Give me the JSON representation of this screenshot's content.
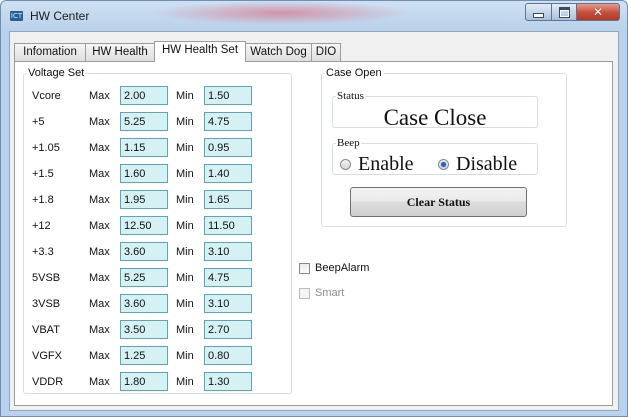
{
  "window": {
    "title": "HW Center",
    "icon_text": "ICT"
  },
  "tabs": [
    {
      "label": "Infomation"
    },
    {
      "label": "HW Health"
    },
    {
      "label": "HW Health Set"
    },
    {
      "label": "Watch Dog"
    },
    {
      "label": "DIO"
    }
  ],
  "active_tab": "HW Health Set",
  "voltage_set": {
    "legend": "Voltage Set",
    "max_label": "Max",
    "min_label": "Min",
    "rows": [
      {
        "name": "Vcore",
        "max": "2.00",
        "min": "1.50"
      },
      {
        "name": "+5",
        "max": "5.25",
        "min": "4.75"
      },
      {
        "name": "+1.05",
        "max": "1.15",
        "min": "0.95"
      },
      {
        "name": "+1.5",
        "max": "1.60",
        "min": "1.40"
      },
      {
        "name": "+1.8",
        "max": "1.95",
        "min": "1.65"
      },
      {
        "name": "+12",
        "max": "12.50",
        "min": "11.50"
      },
      {
        "name": "+3.3",
        "max": "3.60",
        "min": "3.10"
      },
      {
        "name": "5VSB",
        "max": "5.25",
        "min": "4.75"
      },
      {
        "name": "3VSB",
        "max": "3.60",
        "min": "3.10"
      },
      {
        "name": "VBAT",
        "max": "3.50",
        "min": "2.70"
      },
      {
        "name": "VGFX",
        "max": "1.25",
        "min": "0.80"
      },
      {
        "name": "VDDR",
        "max": "1.80",
        "min": "1.30"
      }
    ]
  },
  "case_open": {
    "legend": "Case Open",
    "status_legend": "Status",
    "status_value": "Case Close",
    "beep_legend": "Beep",
    "enable_label": "Enable",
    "disable_label": "Disable",
    "selected": "Disable",
    "clear_button": "Clear Status"
  },
  "options": {
    "beep_alarm_label": "BeepAlarm",
    "beep_alarm_checked": false,
    "smart_label": "Smart",
    "smart_checked": false,
    "smart_enabled": false
  },
  "colors": {
    "field_bg": "#d6f1f4",
    "field_border": "#5aa6b3",
    "radio_selected": "#2a66c8"
  }
}
